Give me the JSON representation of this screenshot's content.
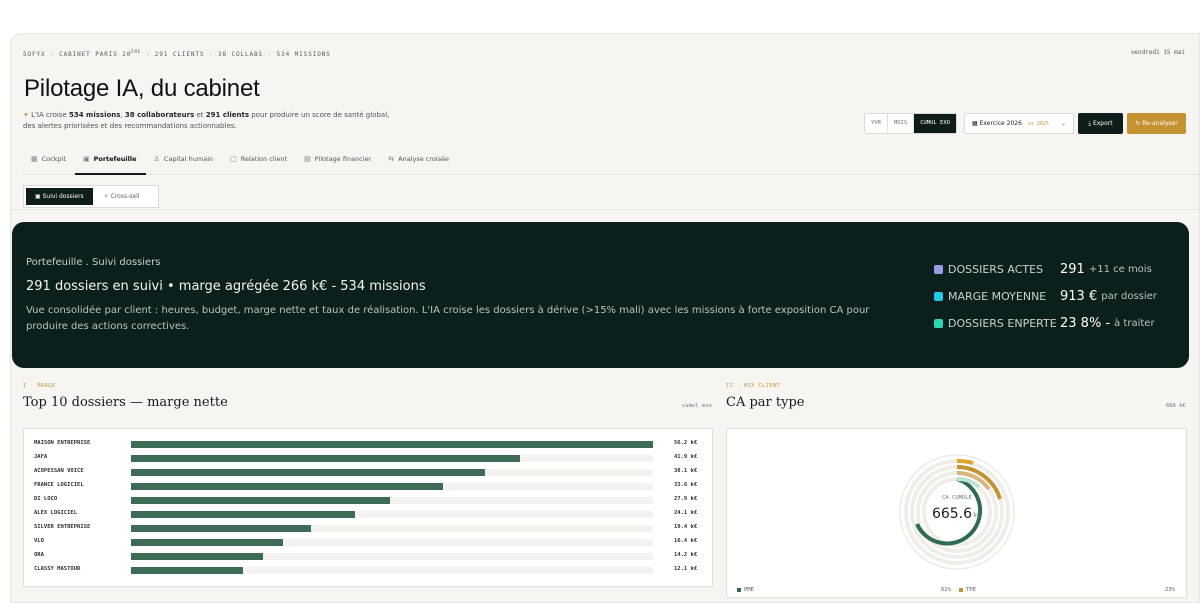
{
  "header": {
    "topline_prefix": "SOFYX · CABINET PARIS 20",
    "topline_sup": "ÈME",
    "topline_suffix": " · 291 CLIENTS · 38 COLLABS · 534 MISSIONS",
    "date": "vendredi 15 mai",
    "title": "Pilotage IA, du cabinet",
    "desc_parts": [
      "L'IA croise ",
      "534 missions",
      ", ",
      "38 collaborateurs",
      " et ",
      "291 clients",
      " pour produire un score de santé global, des alertes priorisées et des recommandations actionnables."
    ]
  },
  "toolbar": {
    "period_options": [
      "YVR",
      "MOIS",
      "CUMUL EXO"
    ],
    "active_period": "CUMUL EXO",
    "exercise_label": "Exercice 2026",
    "compare_label": "vs 2025",
    "export_label": "Export",
    "reanalyse_label": "Re-analyser"
  },
  "tabs": [
    {
      "label": "Cockpit",
      "icon": "grid-icon",
      "active": false
    },
    {
      "label": "Portefeuille",
      "icon": "briefcase-icon",
      "active": true
    },
    {
      "label": "Capital humain",
      "icon": "user-icon",
      "active": false
    },
    {
      "label": "Relation client",
      "icon": "chat-icon",
      "active": false
    },
    {
      "label": "Pilotage financier",
      "icon": "calendar-icon",
      "active": false
    },
    {
      "label": "Analyse croisée",
      "icon": "arrows-icon",
      "active": false
    }
  ],
  "subtabs": [
    {
      "label": "Suivi dossiers",
      "icon": "folder-icon",
      "active": true
    },
    {
      "label": "Cross-sell",
      "icon": "sparkle-icon",
      "active": false
    }
  ],
  "hero": {
    "breadcrumb": "Portefeuille . Suivi dossiers",
    "headline": "291 dossiers en suivi • marge agrégée 266 k€ - 534 missions",
    "text": "Vue consolidée par client : heures, budget, marge nette et taux de réalisation. L'IA croise les dossiers à dérive (>15% mali) avec les missions à forte exposition CA pour produire des actions correctives.",
    "kpis": [
      {
        "label": "DOSSIERS ACTES",
        "value": "291",
        "suffix": "+11 ce mois",
        "color": "#9b9ce8"
      },
      {
        "label": "MARGE MOYENNE",
        "value": "913 €",
        "suffix": "par dossier",
        "color": "#22c8e6"
      },
      {
        "label": "DOSSIERS ENPERTE",
        "value": "23 8% -",
        "suffix": "à traiter",
        "color": "#2ed6b3"
      }
    ]
  },
  "section_marge": {
    "tag": "I · MARGE",
    "title": "Top 10 dossiers — marge nette",
    "note": "cumul exo"
  },
  "section_mix": {
    "tag": "II · MIX CLIENT",
    "title": "CA par type",
    "note": "666 k€",
    "center_label": "CA CUMULÉ",
    "center_value": "665.6",
    "center_unit": "k€",
    "legend": [
      {
        "label": "PME",
        "pct": "62%",
        "color": "#2e6b50"
      },
      {
        "label": "TPE",
        "pct": "23%",
        "color": "#c49231"
      }
    ]
  },
  "chart_data": {
    "type": "bar",
    "title": "Top 10 dossiers — marge nette",
    "categories": [
      "MAISON ENTREPRISE",
      "JAFA",
      "ACOPESSAN VOICE",
      "FRANCE LOGICIEL",
      "DI LOCO",
      "ALEX LOGICIEL",
      "SILVER ENTREPRISE",
      "VLO",
      "ORA",
      "CLASSY MASTOUR"
    ],
    "values": [
      56.2,
      41.9,
      38.1,
      33.6,
      27.9,
      24.1,
      19.4,
      16.4,
      14.2,
      12.1
    ],
    "value_labels": [
      "56.2 k€",
      "41.9 k€",
      "38.1 k€",
      "33.6 k€",
      "27.9 k€",
      "24.1 k€",
      "19.4 k€",
      "16.4 k€",
      "14.2 k€",
      "12.1 k€"
    ],
    "xlim": [
      0,
      56.2
    ],
    "color": "#3d6b55"
  }
}
